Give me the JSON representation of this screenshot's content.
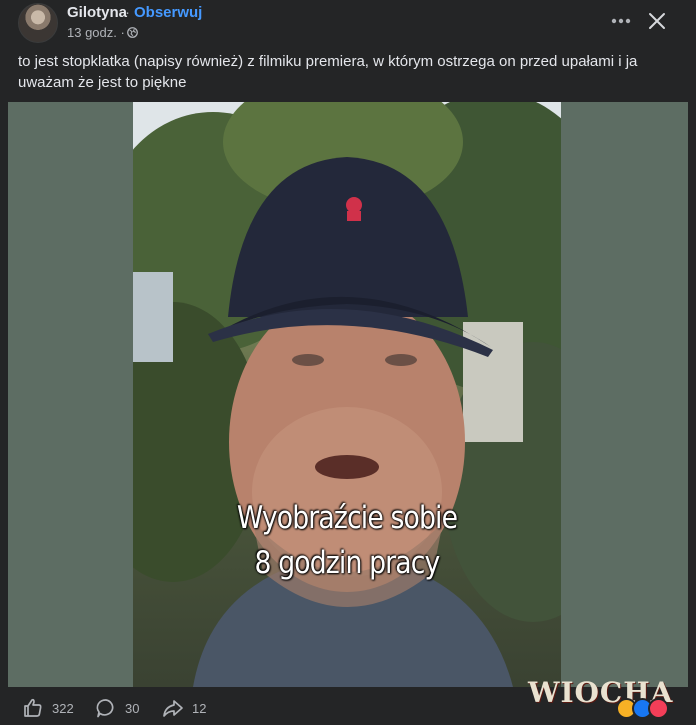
{
  "post": {
    "author": "Gilotyna",
    "separator": "·",
    "follow_label": "Obserwuj",
    "time": "13 godz. ·",
    "caption": "to jest stopklatka (napisy również) z filmiku premiera, w którym ostrzega on przed upałami i ja uważam że jest to piękne"
  },
  "media": {
    "subtitle_line1": "Wyobraźcie sobie",
    "subtitle_line2": "8 godzin pracy"
  },
  "footer": {
    "likes": "322",
    "comments": "30",
    "shares": "12"
  },
  "watermark": {
    "text": "WIOCHA"
  },
  "icons": [
    "globe-icon",
    "more-icon",
    "close-icon",
    "like-icon",
    "comment-icon",
    "share-icon"
  ],
  "colors": {
    "background": "#242526",
    "text": "#e4e6eb",
    "secondary_text": "#b0b3b8",
    "link": "#4599ff",
    "media_background": "#5d6d63"
  }
}
